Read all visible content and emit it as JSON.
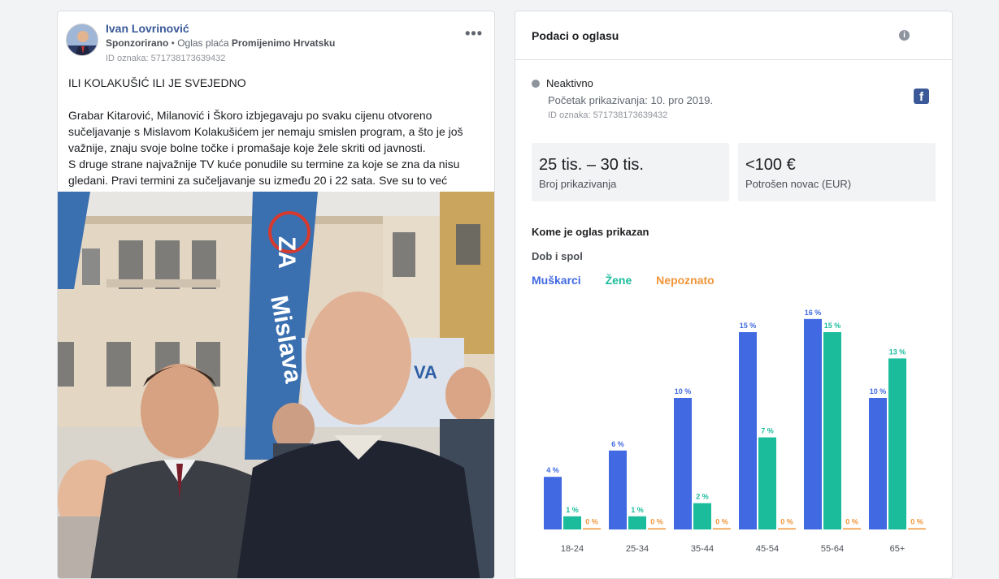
{
  "post": {
    "author": "Ivan Lovrinović",
    "sponsored": "Sponzorirano",
    "paid_by_prefix": " • Oglas plaća ",
    "paid_by": "Promijenimo Hrvatsku",
    "ad_id": "ID oznaka: 571738173639432",
    "more_label": "•••",
    "headline": "ILI KOLAKUŠIĆ ILI JE SVEJEDNO",
    "body_lines": [
      "Grabar Kitarović, Milanović i Škoro izbjegavaju po svaku cijenu otvoreno",
      "sučeljavanje s Mislavom Kolakušićem jer nemaju smislen program, a što je još",
      "važnije, znaju svoje bolne točke i promašaje koje žele skriti od javnosti.",
      "S druge strane najvažnije TV kuće ponudile su termine za koje se zna da nisu",
      "gledani. Pravi termini za sučeljavanje su između 20 i 22 sata. Sve su to već"
    ],
    "banner_text_1": "ZA",
    "banner_text_2": "Mislava",
    "banner_text_3": "VA"
  },
  "panel": {
    "title": "Podaci o oglasu",
    "info_icon": "i",
    "status": "Neaktivno",
    "start": "Početak prikazivanja: 10. pro 2019.",
    "id": "ID oznaka: 571738173639432",
    "fb_icon": "f",
    "impressions_value": "25 tis. – 30 tis.",
    "impressions_label": "Broj prikazivanja",
    "spend_value": "<100 €",
    "spend_label": "Potrošen novac (EUR)",
    "who_title": "Kome je oglas prikazan",
    "age_gender_title": "Dob i spol",
    "legend": {
      "men": "Muškarci",
      "women": "Žene",
      "unknown": "Nepoznato"
    }
  },
  "colors": {
    "men": "#4169e1",
    "women": "#1abc9c",
    "unknown": "#f0953a"
  },
  "chart_data": {
    "type": "bar",
    "categories": [
      "18-24",
      "25-34",
      "35-44",
      "45-54",
      "55-64",
      "65+"
    ],
    "series": [
      {
        "name": "Muškarci",
        "values": [
          4,
          6,
          10,
          15,
          16,
          10
        ],
        "labels": [
          "4 %",
          "6 %",
          "10 %",
          "15 %",
          "16 %",
          "10 %"
        ]
      },
      {
        "name": "Žene",
        "values": [
          1,
          1,
          2,
          7,
          15,
          13
        ],
        "labels": [
          "1 %",
          "1 %",
          "2 %",
          "7 %",
          "15 %",
          "13 %"
        ]
      },
      {
        "name": "Nepoznato",
        "values": [
          0,
          0,
          0,
          0,
          0,
          0
        ],
        "labels": [
          "0 %",
          "0 %",
          "0 %",
          "0 %",
          "0 %",
          "0 %"
        ]
      }
    ],
    "unit": "%"
  }
}
